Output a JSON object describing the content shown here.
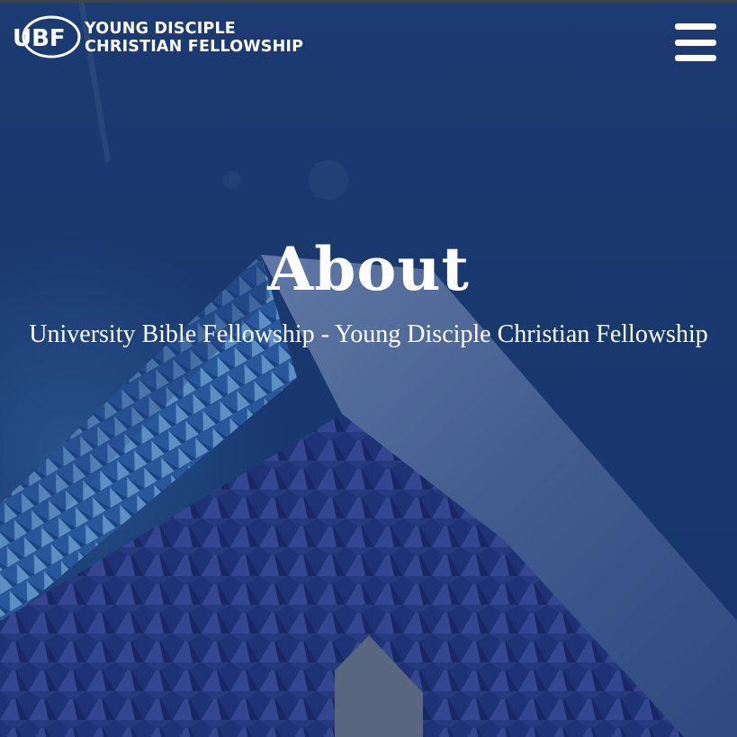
{
  "header": {
    "logo_text": "UBF",
    "brand_line1": "YOUNG DISCIPLE",
    "brand_line2": "CHRISTIAN FELLOWSHIP",
    "menu_icon": "hamburger-menu-icon"
  },
  "hero": {
    "title": "About",
    "subtitle": "University Bible Fellowship - Young Disciple Christian Fellowship",
    "background": "building-facade-image"
  },
  "colors": {
    "background_blue": "#1c3d73",
    "text": "#ffffff"
  }
}
